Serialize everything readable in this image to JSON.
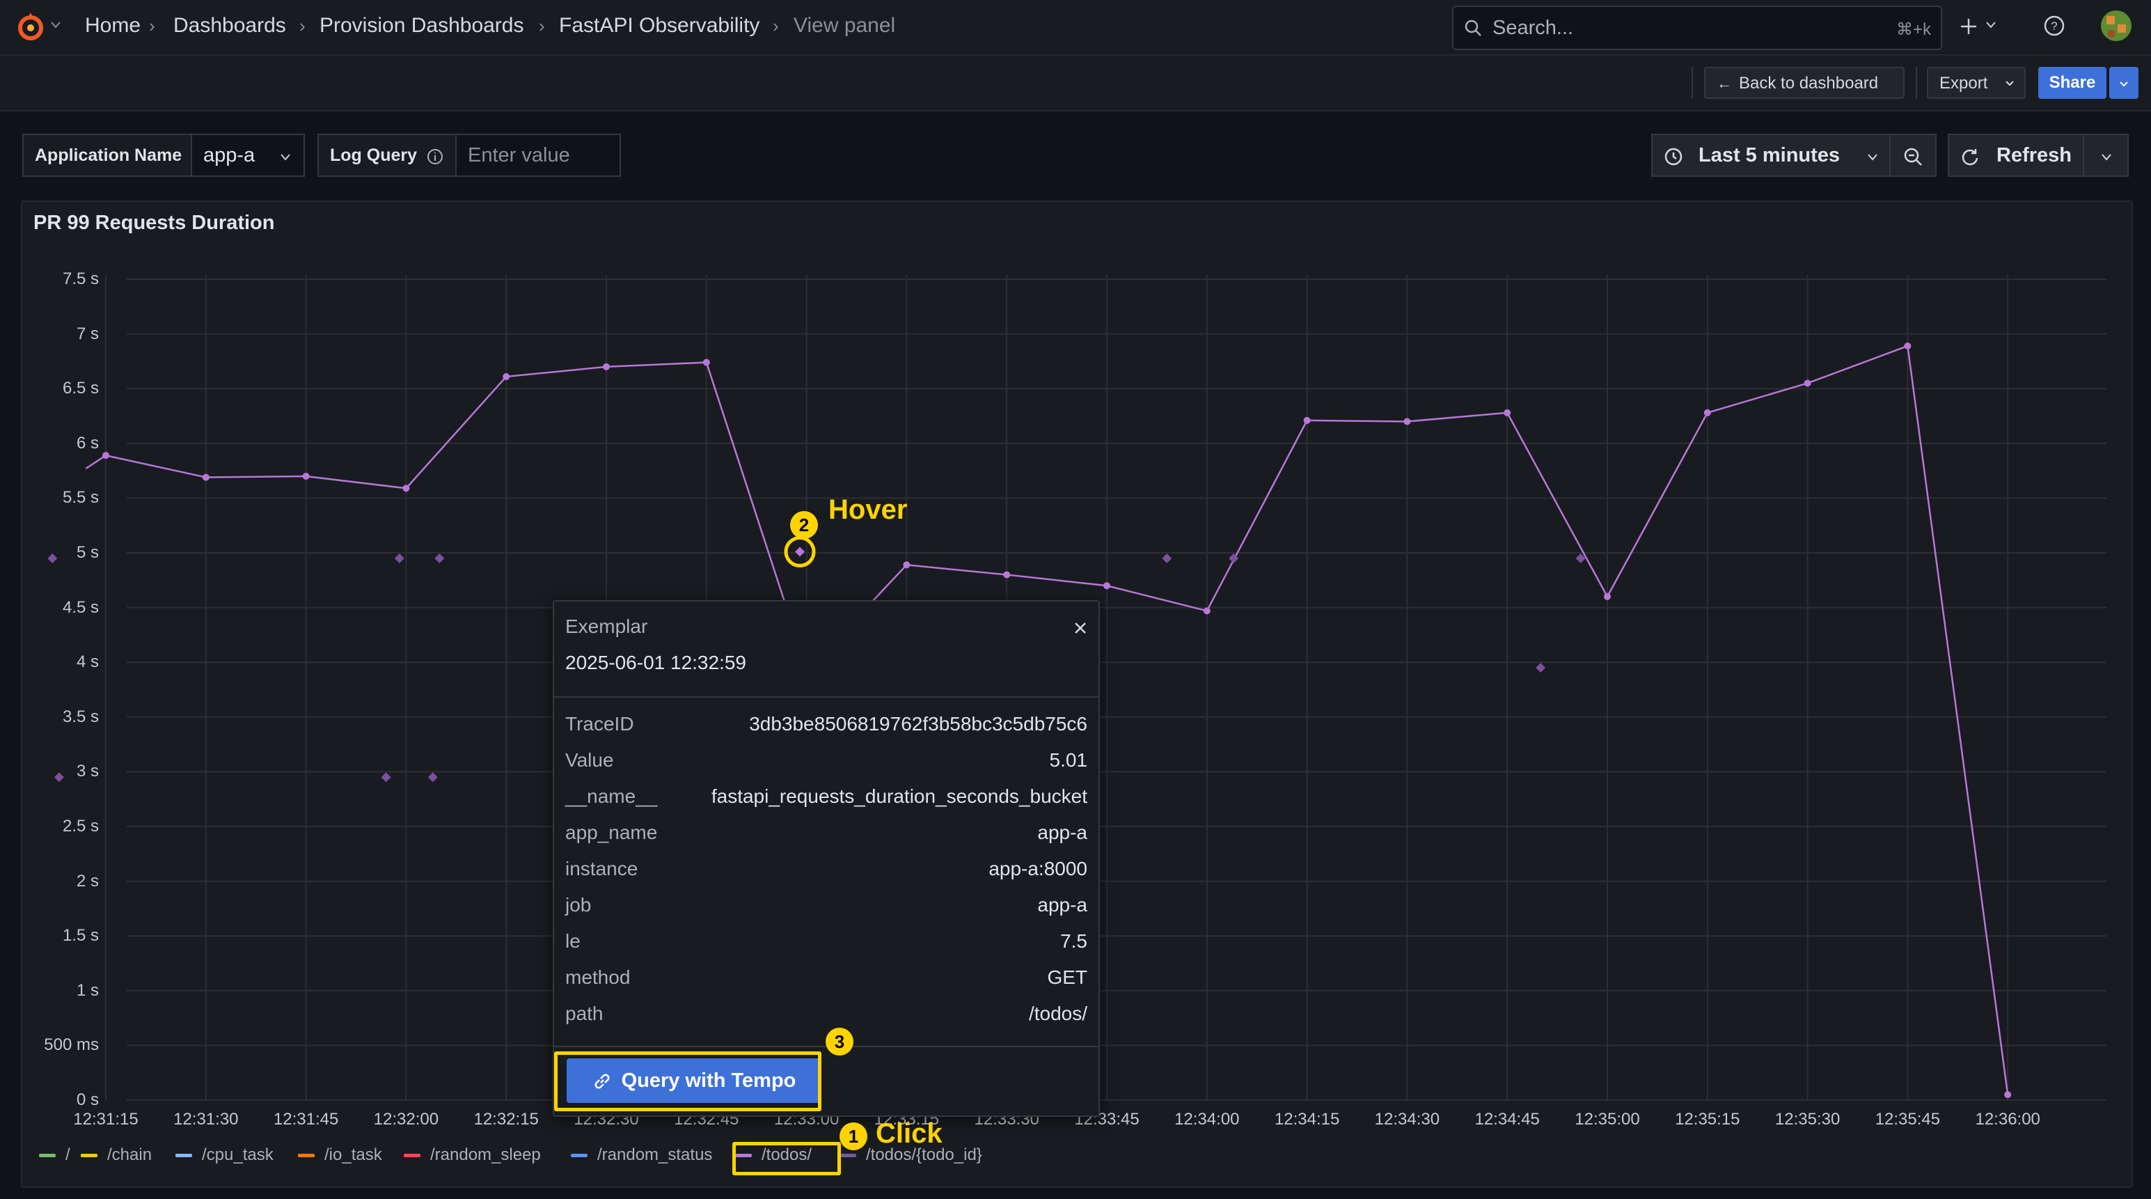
{
  "nav": {
    "breadcrumbs": [
      "Home",
      "Dashboards",
      "Provision Dashboards",
      "FastAPI Observability",
      "View panel"
    ],
    "search_placeholder": "Search...",
    "search_shortcut": "⌘+k"
  },
  "toolbar": {
    "back_label": "Back to dashboard",
    "export_label": "Export",
    "share_label": "Share"
  },
  "variables": {
    "app_label": "Application Name",
    "app_value": "app-a",
    "log_label": "Log Query",
    "log_placeholder": "Enter value"
  },
  "time": {
    "range_label": "Last 5 minutes",
    "refresh_label": "Refresh"
  },
  "panel": {
    "title": "PR 99 Requests Duration"
  },
  "chart_data": {
    "type": "line",
    "title": "PR 99 Requests Duration",
    "y_ticks": [
      "7.5 s",
      "7 s",
      "6.5 s",
      "6 s",
      "5.5 s",
      "5 s",
      "4.5 s",
      "4 s",
      "3.5 s",
      "3 s",
      "2.5 s",
      "2 s",
      "1.5 s",
      "1 s",
      "500 ms",
      "0 s"
    ],
    "ylim": [
      0,
      7.5
    ],
    "x_ticks": [
      "12:31:15",
      "12:31:30",
      "12:31:45",
      "12:32:00",
      "12:32:15",
      "12:32:30",
      "12:32:45",
      "12:33:00",
      "12:33:15",
      "12:33:30",
      "12:33:45",
      "12:34:00",
      "12:34:15",
      "12:34:30",
      "12:34:45",
      "12:35:00",
      "12:35:15",
      "12:35:30",
      "12:35:45",
      "12:36:00"
    ],
    "series": [
      {
        "name": "/todos/",
        "color": "#b877d9",
        "x": [
          "12:31:12",
          "12:31:15",
          "12:31:30",
          "12:31:45",
          "12:32:00",
          "12:32:15",
          "12:32:30",
          "12:32:45",
          "12:32:57",
          "12:33:09",
          "12:33:15",
          "12:33:30",
          "12:33:45",
          "12:34:00",
          "12:34:15",
          "12:34:30",
          "12:34:45",
          "12:35:00",
          "12:35:15",
          "12:35:30",
          "12:35:45",
          "12:36:00"
        ],
        "values": [
          5.77,
          5.89,
          5.69,
          5.7,
          5.59,
          6.61,
          6.7,
          6.74,
          4.5,
          4.5,
          4.89,
          4.8,
          4.7,
          4.47,
          6.21,
          6.2,
          6.28,
          4.6,
          6.28,
          6.55,
          6.89,
          0.05
        ]
      }
    ],
    "exemplars": {
      "x": [
        "12:31:07",
        "12:31:08",
        "12:31:57",
        "12:31:59",
        "12:32:04",
        "12:32:05",
        "12:32:59",
        "12:33:54",
        "12:34:04",
        "12:34:50",
        "12:34:56"
      ],
      "values": [
        4.95,
        2.95,
        2.95,
        4.95,
        2.95,
        4.95,
        5.01,
        4.95,
        4.95,
        3.95,
        4.95
      ]
    },
    "legend": [
      {
        "name": "/",
        "color": "#73bf69"
      },
      {
        "name": "/chain",
        "color": "#f2cc0c"
      },
      {
        "name": "/cpu_task",
        "color": "#8ab8ff"
      },
      {
        "name": "/io_task",
        "color": "#ff780a"
      },
      {
        "name": "/random_sleep",
        "color": "#f2495c"
      },
      {
        "name": "/random_status",
        "color": "#5794f2"
      },
      {
        "name": "/todos/",
        "color": "#b877d9"
      },
      {
        "name": "/todos/{todo_id}",
        "color": "#705da0"
      }
    ],
    "legend_placement": "bottom-left",
    "grid": true
  },
  "exemplar": {
    "title": "Exemplar",
    "timestamp": "2025-06-01 12:32:59",
    "fields": [
      {
        "key": "TraceID",
        "value": "3db3be8506819762f3b58bc3c5db75c6"
      },
      {
        "key": "Value",
        "value": "5.01"
      },
      {
        "key": "__name__",
        "value": "fastapi_requests_duration_seconds_bucket"
      },
      {
        "key": "app_name",
        "value": "app-a"
      },
      {
        "key": "instance",
        "value": "app-a:8000"
      },
      {
        "key": "job",
        "value": "app-a"
      },
      {
        "key": "le",
        "value": "7.5"
      },
      {
        "key": "method",
        "value": "GET"
      },
      {
        "key": "path",
        "value": "/todos/"
      }
    ],
    "query_button": "Query with Tempo"
  },
  "annotations": [
    {
      "number": "1",
      "label": "Click"
    },
    {
      "number": "2",
      "label": "Hover"
    },
    {
      "number": "3",
      "label": ""
    }
  ]
}
